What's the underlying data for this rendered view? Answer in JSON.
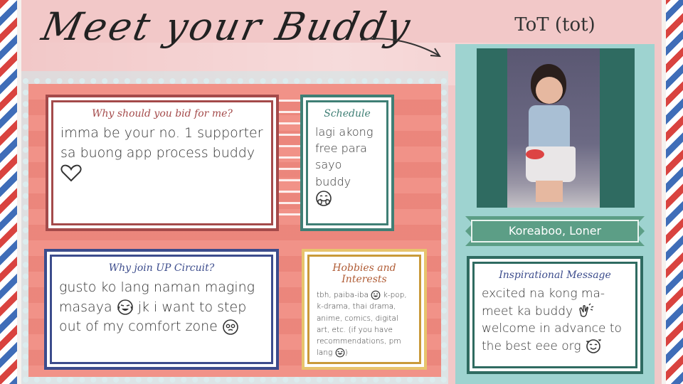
{
  "title": "Meet your Buddy",
  "profile": {
    "name": "ToT (tot)",
    "tags": "Koreaboo, Loner"
  },
  "cards": {
    "why": {
      "title": "Why should you bid for me?",
      "body": "imma be your no. 1 supporter sa buong app process buddy"
    },
    "schedule": {
      "title": "Schedule",
      "body": "lagi akong free para sayo buddy"
    },
    "join": {
      "title": "Why join UP Circuit?",
      "body_a": "gusto ko lang naman maging masaya",
      "body_b": "jk i want to step out of my comfort zone"
    },
    "hobbies": {
      "title": "Hobbies and Interests",
      "body_a": "tbh, paiba-iba",
      "body_b": "k-pop, k-drama, thai drama, anime, comics, digital art, etc. (if you have recommendations, pm lang",
      "body_c": ")"
    },
    "inspirational": {
      "title": "Inspirational Message",
      "body_a": "excited na kong ma-meet ka buddy",
      "body_b": "welcome in advance to the best eee org"
    }
  },
  "colors": {
    "stamp_pink": "#f0897e",
    "panel_teal": "#9ed3d0",
    "why_border": "#a44a4a",
    "schedule_border": "#3f7f75",
    "join_border": "#3c4c8c",
    "hobbies_border": "#e7c46d",
    "tag_green": "#5c9e86"
  },
  "icons": {
    "why": "heart-outline-icon",
    "schedule": "hugging-face-icon",
    "join_a": "crying-laughing-face-icon",
    "join_b": "pleading-face-icon",
    "hobbies_a": "grinning-sweat-face-icon",
    "hobbies_b": "laughing-face-icon",
    "insp_a": "clapping-hands-icon",
    "insp_b": "smiling-hearts-face-icon"
  }
}
